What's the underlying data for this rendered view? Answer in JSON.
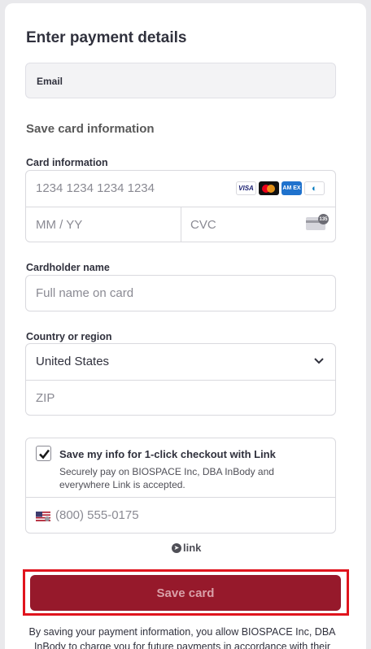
{
  "title": "Enter payment details",
  "email": {
    "label": "Email"
  },
  "save_card": {
    "section_title": "Save card information"
  },
  "card": {
    "label": "Card information",
    "number_placeholder": "1234 1234 1234 1234",
    "expiry_placeholder": "MM / YY",
    "cvc_placeholder": "CVC",
    "brands": [
      "visa-icon",
      "mastercard-icon",
      "amex-icon",
      "diners-icon"
    ],
    "visa_text": "VISA",
    "amex_text": "AM EX",
    "cvc_badge": "135"
  },
  "cardholder": {
    "label": "Cardholder name",
    "placeholder": "Full name on card"
  },
  "country": {
    "label": "Country or region",
    "value": "United States",
    "zip_placeholder": "ZIP"
  },
  "link": {
    "checked": true,
    "title": "Save my info for 1-click checkout with Link",
    "description": "Securely pay on BIOSPACE Inc, DBA InBody and everywhere Link is accepted.",
    "phone_placeholder": "(800) 555-0175",
    "logo_text": "link"
  },
  "save_button": {
    "label": "Save card"
  },
  "footer": {
    "text": "By saving your payment information, you allow BIOSPACE Inc, DBA InBody to charge you for future payments in accordance with their terms."
  },
  "colors": {
    "button_bg": "#96192b",
    "button_text": "#d9a0a8",
    "highlight_outline": "#e0141d"
  }
}
